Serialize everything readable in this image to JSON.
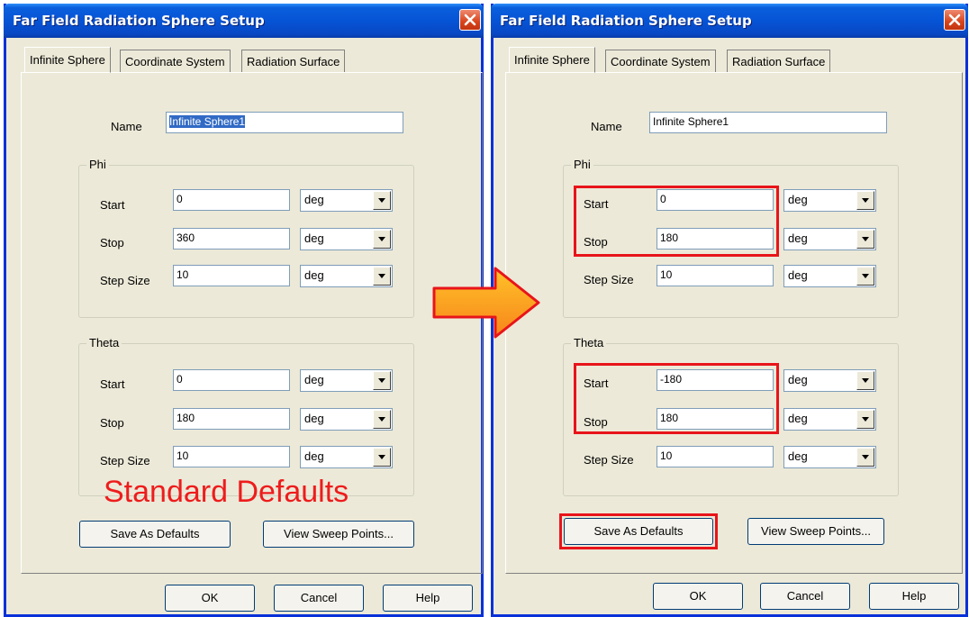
{
  "title": "Far Field Radiation Sphere Setup",
  "tabs": [
    "Infinite Sphere",
    "Coordinate System",
    "Radiation Surface"
  ],
  "labels": {
    "name": "Name",
    "phi": "Phi",
    "theta": "Theta",
    "start": "Start",
    "stop": "Stop",
    "step_size": "Step Size",
    "unit": "deg"
  },
  "buttons": {
    "save_defaults": "Save As Defaults",
    "view_sweep": "View Sweep Points...",
    "ok": "OK",
    "cancel": "Cancel",
    "help": "Help"
  },
  "left": {
    "name": "Infinite Sphere1",
    "phi": {
      "start": "0",
      "stop": "360",
      "step": "10"
    },
    "theta": {
      "start": "0",
      "stop": "180",
      "step": "10"
    },
    "caption": "Standard Defaults"
  },
  "right": {
    "name": "Infinite Sphere1",
    "phi": {
      "start": "0",
      "stop": "180",
      "step": "10"
    },
    "theta": {
      "start": "-180",
      "stop": "180",
      "step": "10"
    }
  },
  "colors": {
    "highlight": "#e8141a",
    "arrow_fill": "#f7931e",
    "title_bar": "#0654d6"
  },
  "icons": {
    "close": "close-x-icon",
    "arrow": "right-arrow-icon",
    "dropdown": "chevron-down-icon"
  }
}
